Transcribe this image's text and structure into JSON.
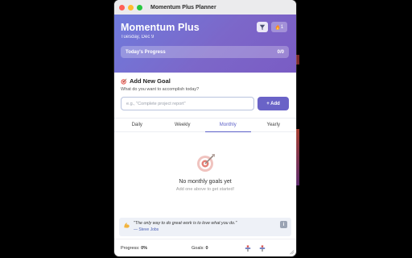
{
  "window": {
    "title": "Momentum Plus Planner"
  },
  "header": {
    "app_title": "Momentum Plus",
    "date": "Tuesday, Dec 9",
    "streak_count": "1",
    "progress_label": "Today's Progress",
    "progress_value": "0/0",
    "progress_fraction": 0
  },
  "add_goal": {
    "title": "Add New Goal",
    "subtitle": "What do you want to accomplish today?",
    "input_placeholder": "e.g., \"Complete project report\"",
    "input_value": "",
    "add_button": "+ Add"
  },
  "tabs": [
    {
      "label": "Daily",
      "active": false
    },
    {
      "label": "Weekly",
      "active": false
    },
    {
      "label": "Monthly",
      "active": true
    },
    {
      "label": "Yearly",
      "active": false
    }
  ],
  "empty_state": {
    "title": "No monthly goals yet",
    "subtitle": "Add one above to get started!"
  },
  "quote": {
    "text": "\"The only way to do great work is to love what you do.\"",
    "author": "— Steve Jobs"
  },
  "status": {
    "progress_label": "Progress:",
    "progress_value": "0%",
    "goals_label": "Goals:",
    "goals_value": "0"
  },
  "icons": {
    "filter": "funnel-icon",
    "streak": "flame-icon",
    "add_goal": "dart-target-icon",
    "empty": "dart-target-icon",
    "quote": "flexed-biceps-icon",
    "info": "info-icon",
    "status_a": "pin-icon",
    "status_b": "pin-icon"
  },
  "colors": {
    "accent": "#6a63c7",
    "header_gradient_start": "#6f7bdc",
    "header_gradient_end": "#7a5cc4",
    "tab_active": "#5b5fc7"
  }
}
